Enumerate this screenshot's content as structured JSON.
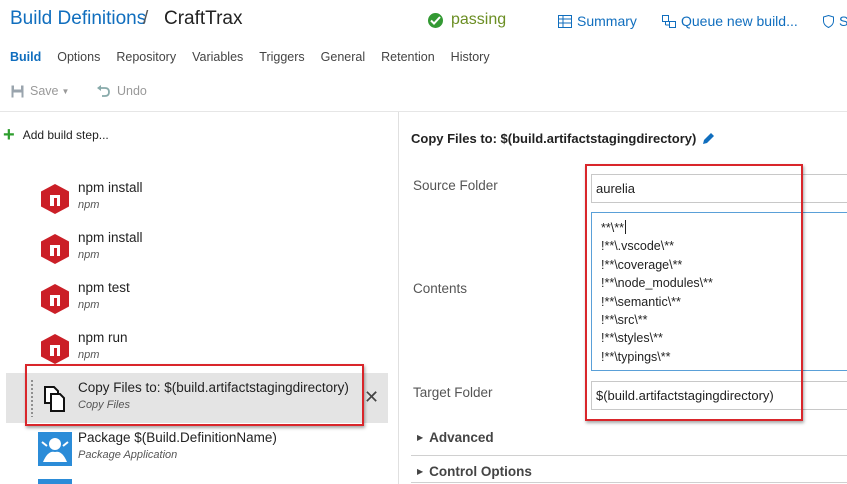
{
  "header": {
    "breadcrumb_root": "Build Definitions",
    "breadcrumb_sep": "/",
    "definition_name": "CraftTrax",
    "status": "passing",
    "status_color": "#339933",
    "links": [
      {
        "label": "Summary",
        "icon": "summary-table-icon"
      },
      {
        "label": "Queue new build...",
        "icon": "queue-build-icon"
      },
      {
        "label": "S",
        "icon": "security-shield-icon"
      }
    ]
  },
  "tabs": [
    {
      "label": "Build",
      "active": true
    },
    {
      "label": "Options"
    },
    {
      "label": "Repository"
    },
    {
      "label": "Variables"
    },
    {
      "label": "Triggers"
    },
    {
      "label": "General"
    },
    {
      "label": "Retention"
    },
    {
      "label": "History"
    }
  ],
  "toolbar": {
    "save_label": "Save",
    "undo_label": "Undo"
  },
  "left_pane": {
    "add_step_label": "Add build step...",
    "tasks": [
      {
        "name": "npm install",
        "subtitle": "npm",
        "icon": "npm-icon"
      },
      {
        "name": "npm install",
        "subtitle": "npm",
        "icon": "npm-icon"
      },
      {
        "name": "npm test",
        "subtitle": "npm",
        "icon": "npm-icon"
      },
      {
        "name": "npm run",
        "subtitle": "npm",
        "icon": "npm-icon"
      },
      {
        "name": "Copy Files to: $(build.artifactstagingdirectory)",
        "subtitle": "Copy Files",
        "icon": "copy-files-icon",
        "selected": true
      },
      {
        "name": "Package $(Build.DefinitionName)",
        "subtitle": "Package Application",
        "icon": "package-icon"
      }
    ],
    "remove_glyph": "✕"
  },
  "detail": {
    "title": "Copy Files to: $(build.artifactstagingdirectory)",
    "source_folder_label": "Source Folder",
    "source_folder_value": "aurelia",
    "contents_label": "Contents",
    "contents_lines": [
      "**\\**",
      "!**\\.vscode\\**",
      "!**\\coverage\\**",
      "!**\\node_modules\\**",
      "!**\\semantic\\**",
      "!**\\src\\**",
      "!**\\styles\\**",
      "!**\\typings\\**"
    ],
    "target_folder_label": "Target Folder",
    "target_folder_value": "$(build.artifactstagingdirectory)",
    "advanced_label": "Advanced",
    "control_options_label": "Control Options"
  },
  "colors": {
    "accent": "#106ebe",
    "highlight_box": "#d9262b",
    "npm_red": "#cb1f27",
    "add_green": "#2e9e2e"
  }
}
